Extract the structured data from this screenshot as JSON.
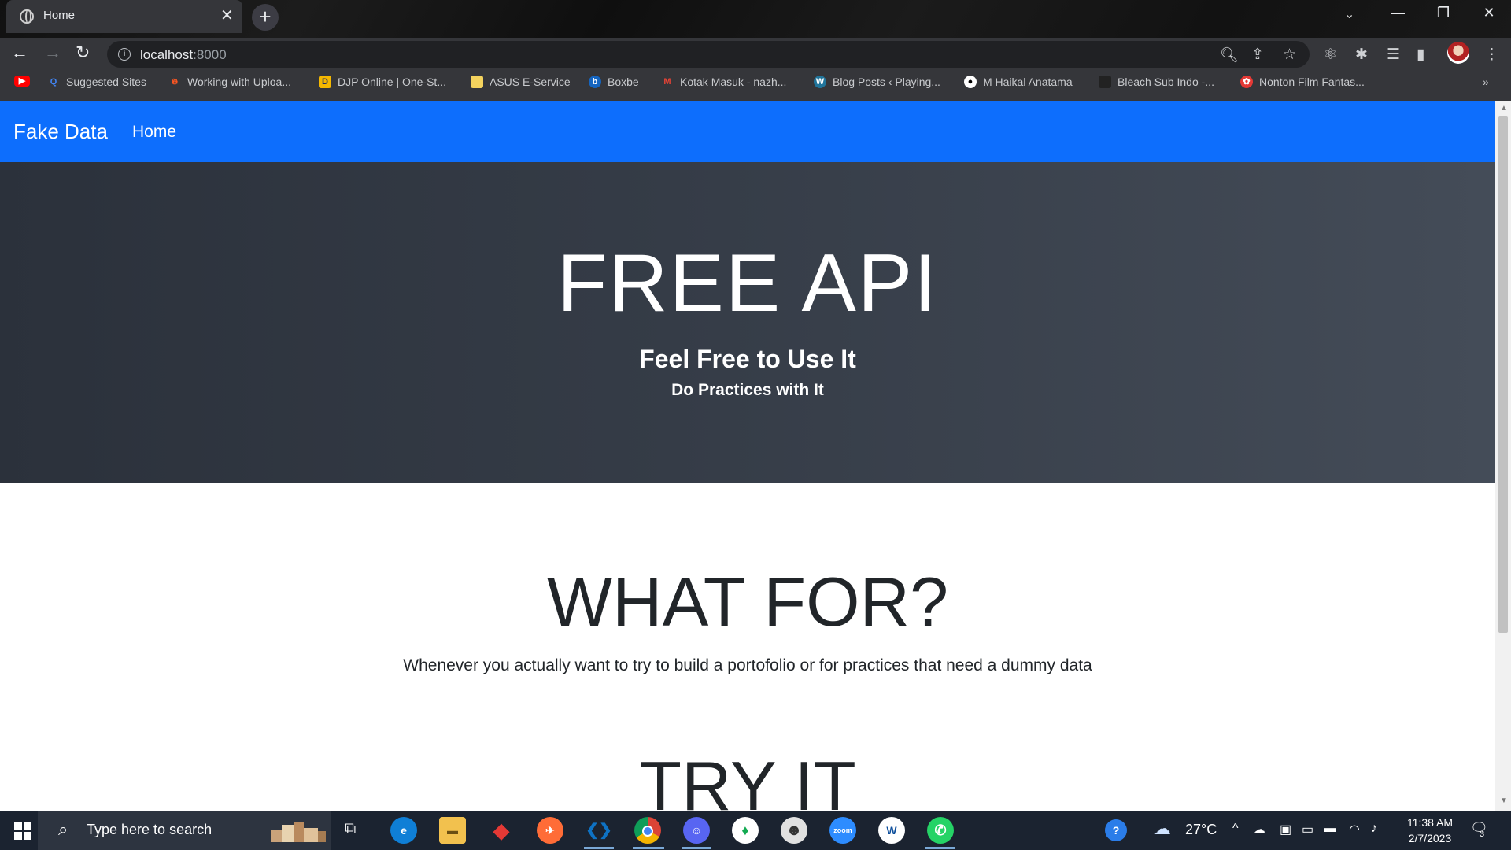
{
  "tab": {
    "title": "Home",
    "close": "✕"
  },
  "window": {
    "minimize": "—",
    "restore": "❐",
    "close": "✕"
  },
  "toolbar": {
    "url_host": "localhost",
    "url_port": ":8000"
  },
  "bookmarks": [
    {
      "label": "Suggested Sites",
      "icon": "search-icon",
      "color": "#4285f4"
    },
    {
      "label": "Working with Uploa...",
      "icon": "fire-icon",
      "color": "#ff5722"
    },
    {
      "label": "DJP Online | One-St...",
      "icon": "djp-icon",
      "color": "#f5b800"
    },
    {
      "label": "ASUS E-Service",
      "icon": "folder-icon",
      "color": "#f4d35e"
    },
    {
      "label": "Boxbe",
      "icon": "boxbe-icon",
      "color": "#1565c0"
    },
    {
      "label": "Kotak Masuk - nazh...",
      "icon": "gmail-icon",
      "color": "#ea4335"
    },
    {
      "label": "Blog Posts ‹ Playing...",
      "icon": "wordpress-icon",
      "color": "#21759b"
    },
    {
      "label": "M Haikal Anatama",
      "icon": "github-icon",
      "color": "#ffffff"
    },
    {
      "label": "Bleach Sub Indo -...",
      "icon": "bleach-icon",
      "color": "#222222"
    },
    {
      "label": "Nonton Film Fantas...",
      "icon": "film-icon",
      "color": "#e53935"
    }
  ],
  "page": {
    "brand": "Fake Data",
    "nav_home": "Home",
    "hero_title": "FREE API",
    "hero_subtitle": "Feel Free to Use It",
    "hero_subtitle2": "Do Practices with It",
    "what_title": "WHAT FOR?",
    "what_text": "Whenever you actually want to try to build a portofolio or for practices that need a dummy data",
    "try_title": "TRY IT",
    "colors": {
      "navbar": "#0d6efd",
      "hero": "#353c47"
    }
  },
  "taskbar": {
    "search_placeholder": "Type here to search",
    "apps": [
      {
        "name": "edge",
        "glyph": "e",
        "color": "#0f7fd6"
      },
      {
        "name": "file-explorer",
        "glyph": "▬",
        "color": "#f2c14e"
      },
      {
        "name": "app-red",
        "glyph": "◆",
        "color": "#e53935"
      },
      {
        "name": "postman",
        "glyph": "✈",
        "color": "#ff6c37"
      },
      {
        "name": "vscode",
        "glyph": "❮❯",
        "color": "#0e72c4"
      },
      {
        "name": "chrome",
        "glyph": "◉",
        "color": "#db4437"
      },
      {
        "name": "discord",
        "glyph": "☺",
        "color": "#5865f2"
      },
      {
        "name": "mongodb",
        "glyph": "♦",
        "color": "#13aa52"
      },
      {
        "name": "app-avatar",
        "glyph": "☻",
        "color": "#e0e0e0"
      },
      {
        "name": "zoom",
        "glyph": "zoom",
        "color": "#2d8cff"
      },
      {
        "name": "app-w",
        "glyph": "W",
        "color": "#ffffff"
      },
      {
        "name": "whatsapp",
        "glyph": "✆",
        "color": "#25d366"
      }
    ],
    "weather": "27°C",
    "time": "11:38 AM",
    "date": "2/7/2023",
    "notifications": "3"
  }
}
